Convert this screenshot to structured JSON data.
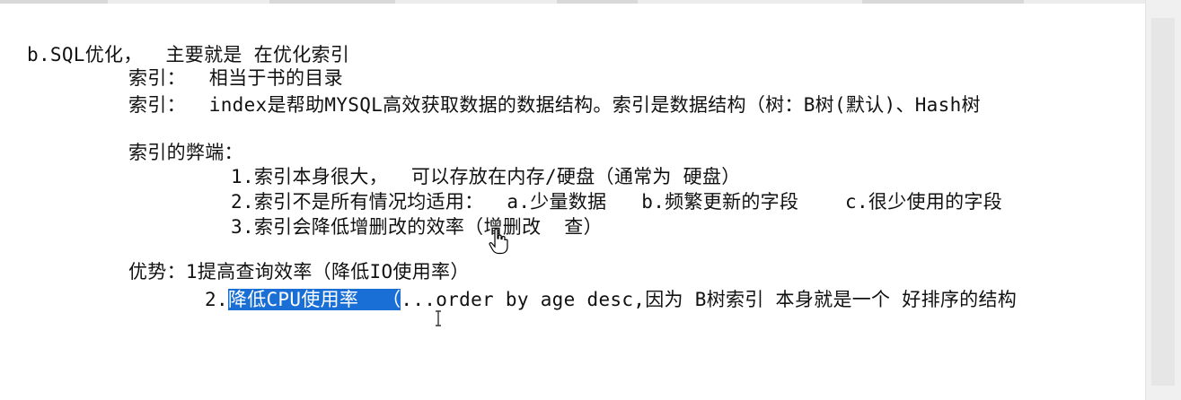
{
  "document": {
    "lines": [
      "b.SQL优化，  主要就是 在优化索引",
      "索引：  相当于书的目录",
      "索引：  index是帮助MYSQL高效获取数据的数据结构。索引是数据结构（树：B树(默认)、Hash树",
      "索引的弊端：",
      "1.索引本身很大，  可以存放在内存/硬盘（通常为 硬盘）",
      "2.索引不是所有情况均适用：  a.少量数据   b.频繁更新的字段    c.很少使用的字段",
      "3.索引会降低增删改的效率（增删改  查）",
      "优势：1提高查询效率（降低IO使用率）",
      "2.",
      "降低CPU使用率  （",
      "...order by age desc,因为 B树索引 本身就是一个 好排序的结构"
    ]
  },
  "cursors": {
    "hand": "hand-pointer-cursor-icon",
    "text": "text-ibeam-cursor-icon"
  },
  "colors": {
    "selection": "#1a6fd6",
    "text": "#111111",
    "background": "#ffffff"
  }
}
